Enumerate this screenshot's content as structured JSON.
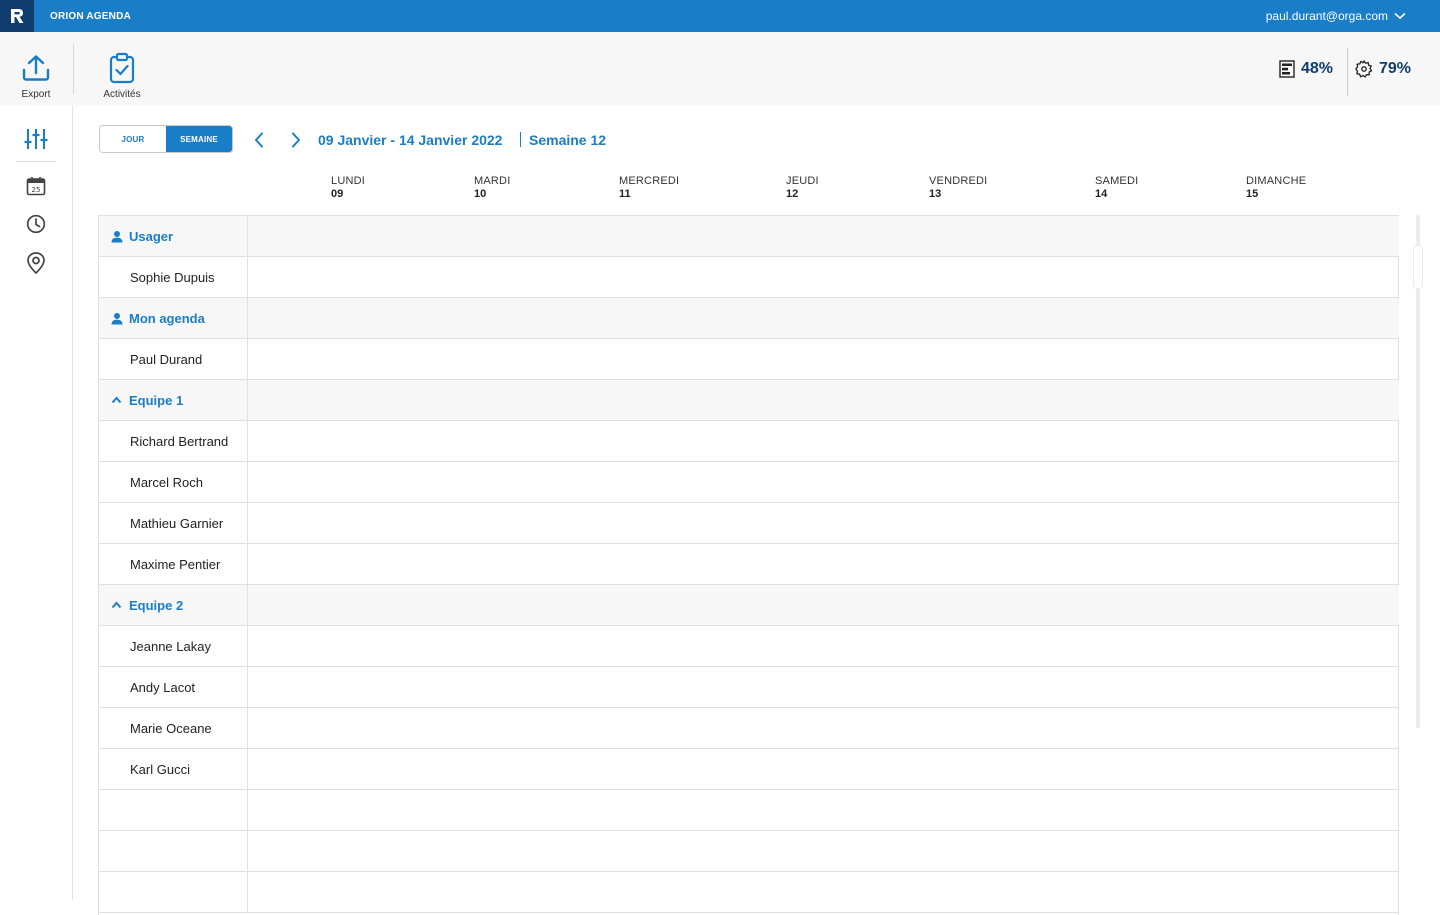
{
  "app": {
    "title": "ORION AGENDA",
    "user_email": "paul.durant@orga.com",
    "accent": "#1a7dc8",
    "dark": "#0f3d6e"
  },
  "toolbar": {
    "export_label": "Export",
    "activities_label": "Activités",
    "stat1_value": "48%",
    "stat1_icon": "list-gauge-icon",
    "stat2_value": "79%",
    "stat2_icon": "gear-badge-icon"
  },
  "sidebar": {
    "items": [
      {
        "icon": "sliders-icon"
      },
      {
        "icon": "calendar-25-icon"
      },
      {
        "icon": "clock-icon"
      },
      {
        "icon": "map-pin-icon"
      }
    ]
  },
  "view_toggle": {
    "day_label": "JOUR",
    "week_label": "SEMAINE",
    "selected": "SEMAINE"
  },
  "period": {
    "range": "09 Janvier - 14 Janvier 2022",
    "week": "Semaine 12"
  },
  "days": [
    {
      "name": "LUNDI",
      "num": "09"
    },
    {
      "name": "MARDI",
      "num": "10"
    },
    {
      "name": "MERCREDI",
      "num": "11"
    },
    {
      "name": "JEUDI",
      "num": "12"
    },
    {
      "name": "VENDREDI",
      "num": "13"
    },
    {
      "name": "SAMEDI",
      "num": "14"
    },
    {
      "name": "DIMANCHE",
      "num": "15"
    }
  ],
  "rows": [
    {
      "type": "group",
      "label": "Usager",
      "icon": "user-icon"
    },
    {
      "type": "person",
      "label": "Sophie Dupuis"
    },
    {
      "type": "group",
      "label": "Mon agenda",
      "icon": "user-icon"
    },
    {
      "type": "person",
      "label": "Paul Durand"
    },
    {
      "type": "group",
      "label": "Equipe 1",
      "icon": "chevron-up-icon"
    },
    {
      "type": "person",
      "label": "Richard Bertrand"
    },
    {
      "type": "person",
      "label": "Marcel Roch"
    },
    {
      "type": "person",
      "label": "Mathieu Garnier"
    },
    {
      "type": "person",
      "label": "Maxime Pentier"
    },
    {
      "type": "group",
      "label": "Equipe 2",
      "icon": "chevron-up-icon"
    },
    {
      "type": "person",
      "label": "Jeanne Lakay"
    },
    {
      "type": "person",
      "label": "Andy Lacot"
    },
    {
      "type": "person",
      "label": "Marie Oceane"
    },
    {
      "type": "person",
      "label": "Karl Gucci"
    },
    {
      "type": "empty",
      "label": ""
    },
    {
      "type": "empty",
      "label": ""
    },
    {
      "type": "empty",
      "label": ""
    }
  ]
}
